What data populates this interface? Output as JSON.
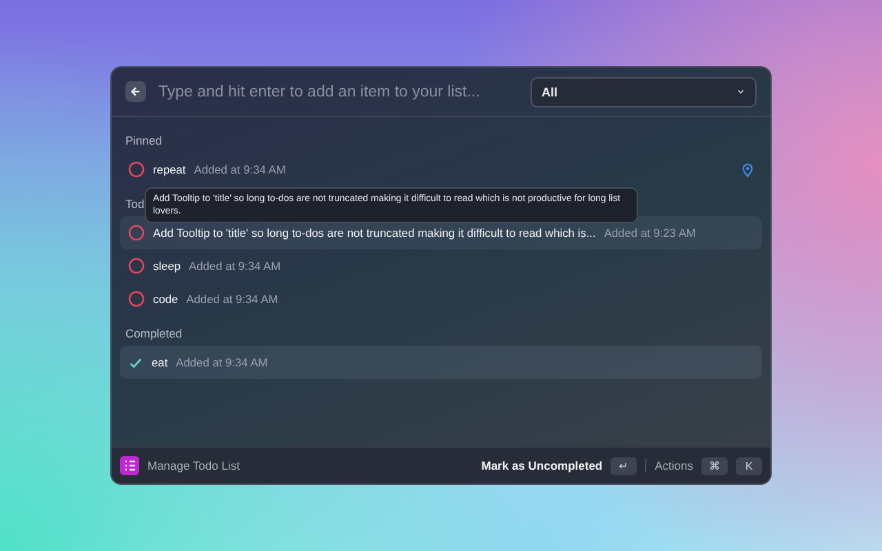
{
  "search": {
    "placeholder": "Type and hit enter to add an item to your list..."
  },
  "filter": {
    "value": "All"
  },
  "sections": [
    {
      "heading": "Pinned",
      "items": [
        {
          "title": "repeat",
          "time": "Added at 9:34 AM",
          "completed": false,
          "pinned": true,
          "selected": false,
          "hovered": false
        }
      ]
    },
    {
      "heading": "Tod",
      "tooltip": "Add Tooltip to 'title' so long to-dos are not truncated making it difficult to read which is not productive for long list lovers.",
      "items": [
        {
          "title": "Add Tooltip to 'title' so long to-dos are not truncated making it difficult to read which is...",
          "time": "Added at 9:23 AM",
          "completed": false,
          "pinned": false,
          "selected": false,
          "hovered": true
        },
        {
          "title": "sleep",
          "time": "Added at 9:34 AM",
          "completed": false,
          "pinned": false,
          "selected": false,
          "hovered": false
        },
        {
          "title": "code",
          "time": "Added at 9:34 AM",
          "completed": false,
          "pinned": false,
          "selected": false,
          "hovered": false
        }
      ]
    },
    {
      "heading": "Completed",
      "items": [
        {
          "title": "eat",
          "time": "Added at 9:34 AM",
          "completed": true,
          "pinned": false,
          "selected": true,
          "hovered": false
        }
      ]
    }
  ],
  "footer": {
    "title": "Manage Todo List",
    "primary_action": "Mark as Uncompleted",
    "primary_key": "↵",
    "actions": "Actions",
    "action_keys": [
      "⌘",
      "K"
    ]
  }
}
